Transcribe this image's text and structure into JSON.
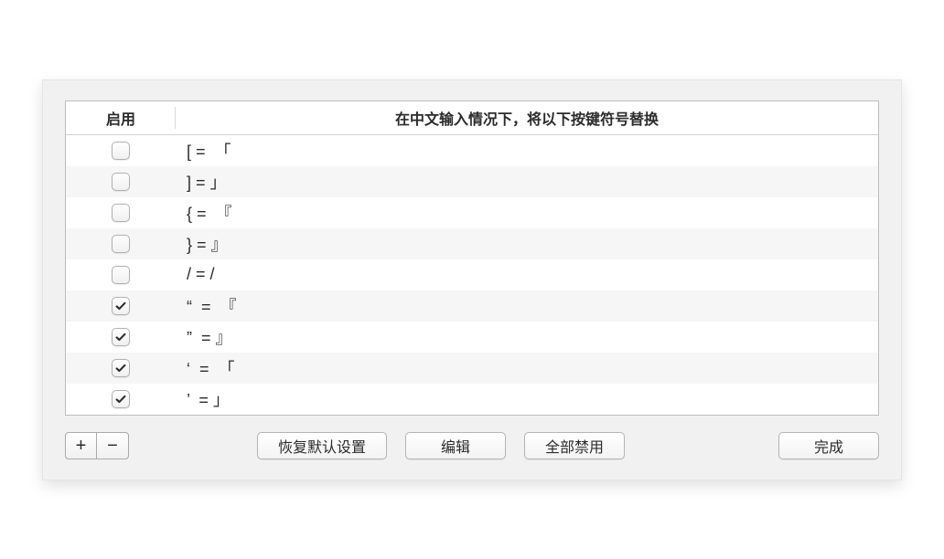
{
  "columns": {
    "enable": "启用",
    "rule": "在中文输入情况下，将以下按键符号替换"
  },
  "rules": [
    {
      "enabled": false,
      "text": "[ =  「"
    },
    {
      "enabled": false,
      "text": "] = 」"
    },
    {
      "enabled": false,
      "text": "{ =  『"
    },
    {
      "enabled": false,
      "text": "} = 』"
    },
    {
      "enabled": false,
      "text": "/ = /"
    },
    {
      "enabled": true,
      "text": "“  =  『"
    },
    {
      "enabled": true,
      "text": "”  = 』"
    },
    {
      "enabled": true,
      "text": "‘  =  「"
    },
    {
      "enabled": true,
      "text": "’  = 」"
    }
  ],
  "buttons": {
    "add": "+",
    "remove": "−",
    "restore": "恢复默认设置",
    "edit": "编辑",
    "disable_all": "全部禁用",
    "done": "完成"
  }
}
